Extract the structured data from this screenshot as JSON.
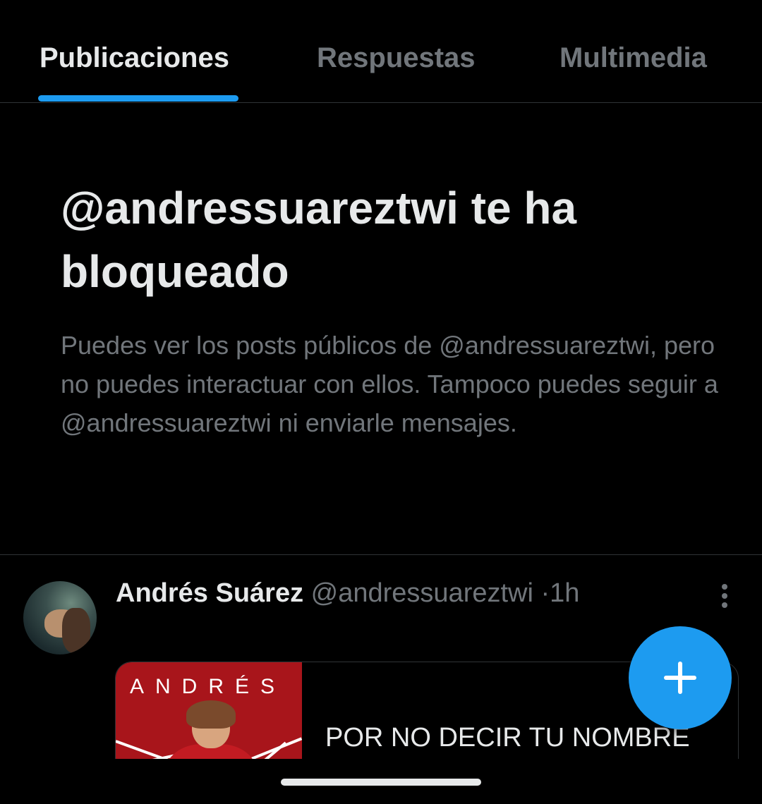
{
  "tabs": [
    {
      "label": "Publicaciones",
      "active": true
    },
    {
      "label": "Respuestas",
      "active": false
    },
    {
      "label": "Multimedia",
      "active": false
    }
  ],
  "blocked": {
    "title": "@andressuareztwi te ha bloqueado",
    "description": "Puedes ver los posts públicos de @andressuareztwi, pero no puedes interactuar con ellos. Tampoco puedes seguir a @andressuareztwi ni enviarle mensajes."
  },
  "post": {
    "author_name": "Andrés Suárez",
    "handle": "@andressuareztwi",
    "separator": "·",
    "time": "1h",
    "card": {
      "thumbnail_text": "ANDRÉS",
      "title": "POR NO DECIR TU NOMBRE"
    }
  },
  "colors": {
    "accent": "#1d9bf0",
    "background": "#000000",
    "primary_text": "#e7e9ea",
    "secondary_text": "#71767b",
    "divider": "#2f3336"
  },
  "icons": {
    "more": "more-vertical-icon",
    "compose": "plus-icon"
  }
}
